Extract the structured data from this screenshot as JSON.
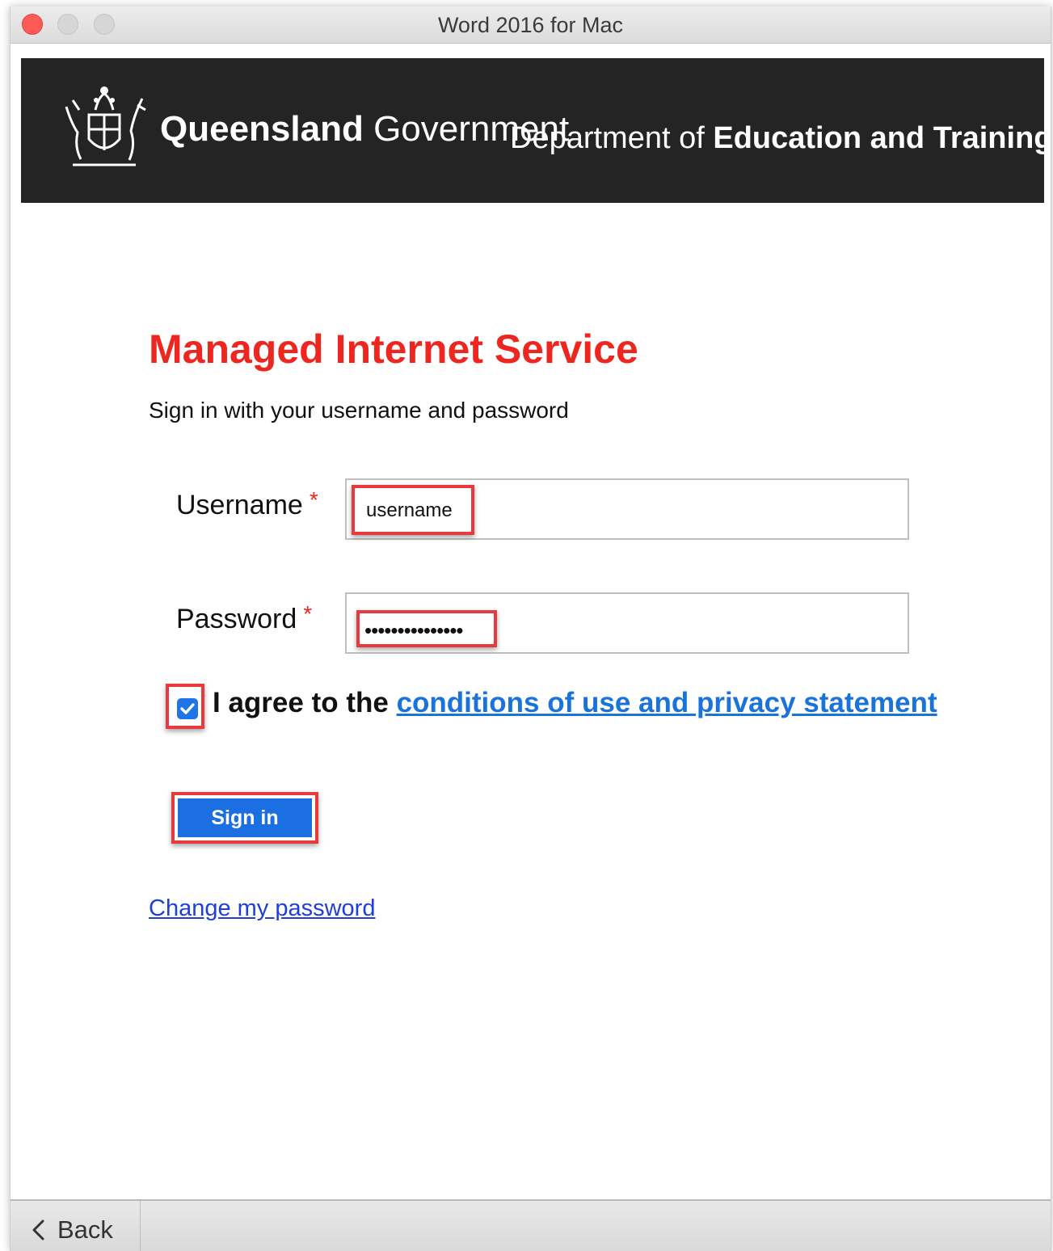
{
  "window": {
    "title": "Word 2016 for Mac"
  },
  "banner": {
    "gov_name_bold": "Queensland",
    "gov_name_light": "Government",
    "dept_prefix": "Department of",
    "dept_name": "Education and Training"
  },
  "main": {
    "heading": "Managed Internet Service",
    "subtitle": "Sign in with your username and password",
    "username": {
      "label": "Username",
      "required_mark": "*",
      "value": "username"
    },
    "password": {
      "label": "Password",
      "required_mark": "*",
      "value": "•••••••••••••••"
    },
    "agree": {
      "checked": true,
      "prefix": "I agree to the",
      "link": "conditions of use and privacy statement"
    },
    "signin_label": "Sign in",
    "change_password_link": "Change my password"
  },
  "bottom": {
    "back_label": "Back"
  },
  "colors": {
    "heading": "#ee2620",
    "button": "#1c6fe3",
    "link": "#1a73d9",
    "highlight": "#e8393c",
    "banner": "#242424"
  },
  "icons": [
    "close-icon",
    "minimize-icon",
    "maximize-icon",
    "queensland-crest-logo",
    "checkmark-icon",
    "chevron-left-icon"
  ]
}
